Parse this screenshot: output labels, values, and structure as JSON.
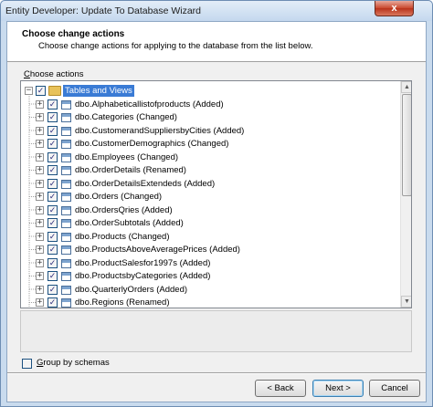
{
  "window": {
    "title": "Entity Developer: Update To Database Wizard",
    "close_glyph": "x"
  },
  "header": {
    "title": "Choose change actions",
    "subtitle": "Choose change actions for applying to the database from the list below."
  },
  "actions_group": {
    "label_prefix": "C",
    "label_rest": "hoose actions"
  },
  "tree": {
    "root": {
      "label": "Tables and Views",
      "checked": true,
      "expanded": true,
      "icon": "folder-icon"
    },
    "items": [
      {
        "label": "dbo.Alphabeticallistofproducts (Added)",
        "checked": true
      },
      {
        "label": "dbo.Categories (Changed)",
        "checked": true
      },
      {
        "label": "dbo.CustomerandSuppliersbyCities (Added)",
        "checked": true
      },
      {
        "label": "dbo.CustomerDemographics (Changed)",
        "checked": true
      },
      {
        "label": "dbo.Employees (Changed)",
        "checked": true
      },
      {
        "label": "dbo.OrderDetails (Renamed)",
        "checked": true
      },
      {
        "label": "dbo.OrderDetailsExtendeds (Added)",
        "checked": true
      },
      {
        "label": "dbo.Orders (Changed)",
        "checked": true
      },
      {
        "label": "dbo.OrdersQries (Added)",
        "checked": true
      },
      {
        "label": "dbo.OrderSubtotals (Added)",
        "checked": true
      },
      {
        "label": "dbo.Products (Changed)",
        "checked": true
      },
      {
        "label": "dbo.ProductsAboveAveragePrices (Added)",
        "checked": true
      },
      {
        "label": "dbo.ProductSalesfor1997s (Added)",
        "checked": true
      },
      {
        "label": "dbo.ProductsbyCategories (Added)",
        "checked": true
      },
      {
        "label": "dbo.QuarterlyOrders (Added)",
        "checked": true
      },
      {
        "label": "dbo.Regions (Renamed)",
        "checked": true
      }
    ],
    "expand_glyph": "+",
    "collapse_glyph": "−",
    "check_glyph": "✓"
  },
  "scrollbar": {
    "up_glyph": "▲",
    "down_glyph": "▼"
  },
  "group_by_schemas": {
    "label_prefix": "G",
    "label_rest": "roup by schemas",
    "checked": false
  },
  "buttons": {
    "back": "< Back",
    "next": "Next >",
    "cancel": "Cancel"
  }
}
